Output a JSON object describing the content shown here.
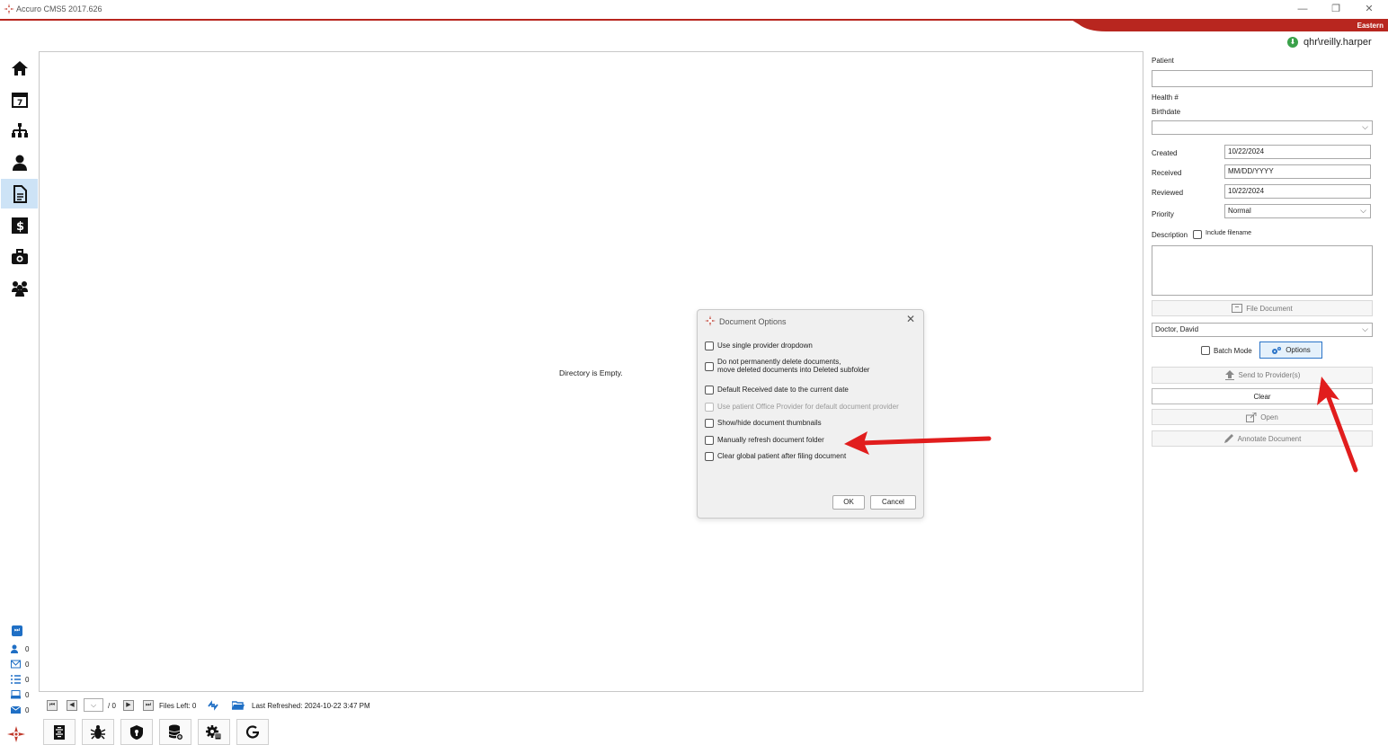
{
  "window": {
    "title": "Accuro CMS5 2017.626",
    "minimize": "—",
    "restore": "❐",
    "close": "✕",
    "timezone": "Eastern",
    "user": "qhr\\reilly.harper"
  },
  "colors": {
    "accent_red": "#b8261f",
    "active_nav": "#cde3f6",
    "options_blue": "#2b74c8"
  },
  "left_nav": [
    {
      "name": "home-icon"
    },
    {
      "name": "calendar-icon"
    },
    {
      "name": "org-chart-icon"
    },
    {
      "name": "patient-icon"
    },
    {
      "name": "document-icon",
      "active": true
    },
    {
      "name": "billing-icon"
    },
    {
      "name": "medical-bag-icon"
    },
    {
      "name": "group-icon"
    }
  ],
  "viewer": {
    "empty_text": "Directory is Empty."
  },
  "counts": [
    {
      "icon": "user-task-icon",
      "value": "0"
    },
    {
      "icon": "mail-icon",
      "value": "0"
    },
    {
      "icon": "list-icon",
      "value": "0"
    },
    {
      "icon": "inbox-icon",
      "value": "0"
    },
    {
      "icon": "message-icon",
      "value": "0"
    }
  ],
  "bottom_bar": {
    "first": "⏮",
    "prev": "◀",
    "page_select": "⌵",
    "page_total": "/ 0",
    "next": "▶",
    "last": "⏭",
    "files_left": "Files Left: 0",
    "last_refreshed": "Last Refreshed: 2024-10-22 3:47 PM"
  },
  "right_panel": {
    "patient_label": "Patient",
    "patient_value": "",
    "health_label": "Health #",
    "birthdate_label": "Birthdate",
    "birthdate_value": "",
    "created_label": "Created",
    "created_value": "10/22/2024",
    "received_label": "Received",
    "received_value": "MM/DD/YYYY",
    "reviewed_label": "Reviewed",
    "reviewed_value": "10/22/2024",
    "priority_label": "Priority",
    "priority_value": "Normal",
    "description_label": "Description",
    "include_filename_label": "Include filename",
    "description_value": "",
    "file_document": "File Document",
    "provider_value": "Doctor, David",
    "batch_mode_label": "Batch Mode",
    "options_label": "Options",
    "send_to_provider": "Send to Provider(s)",
    "clear": "Clear",
    "open": "Open",
    "annotate_document": "Annotate Document"
  },
  "dialog": {
    "title": "Document Options",
    "close": "✕",
    "options": [
      {
        "label": "Use single provider dropdown",
        "checked": false,
        "enabled": true
      },
      {
        "label": "Do not permanently delete documents,",
        "label2": "move deleted documents into Deleted subfolder",
        "checked": false,
        "enabled": true
      },
      {
        "label": "Default Received date to the current date",
        "checked": false,
        "enabled": true
      },
      {
        "label": "Use patient Office Provider for default document provider",
        "checked": false,
        "enabled": false
      },
      {
        "label": "Show/hide document thumbnails",
        "checked": false,
        "enabled": true
      },
      {
        "label": "Manually refresh document folder",
        "checked": false,
        "enabled": true
      },
      {
        "label": "Clear global patient after filing document",
        "checked": false,
        "enabled": true
      }
    ],
    "ok": "OK",
    "cancel": "Cancel"
  }
}
